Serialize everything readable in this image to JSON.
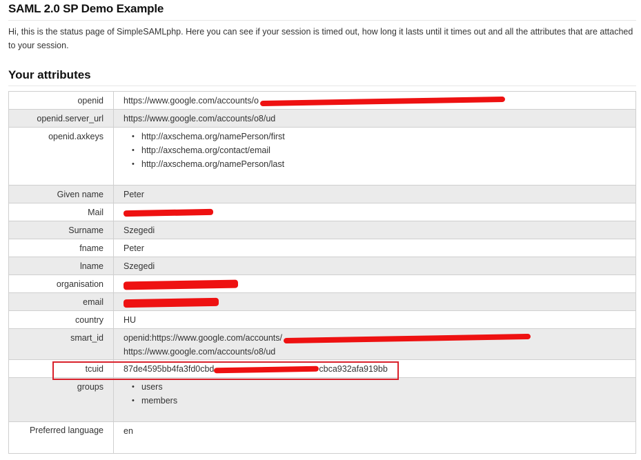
{
  "page": {
    "title": "SAML 2.0 SP Demo Example",
    "intro": "Hi, this is the status page of SimpleSAMLphp. Here you can see if your session is timed out, how long it lasts until it times out and all the attributes that are attached to your session.",
    "section_title": "Your attributes"
  },
  "attributes": [
    {
      "key": "openid",
      "value": "https://www.google.com/accounts/o8/id?id=AItOawkxyzRNjjjg...",
      "redacted": true
    },
    {
      "key": "openid.server_url",
      "value": "https://www.google.com/accounts/o8/ud"
    },
    {
      "key": "openid.axkeys",
      "items": [
        "http://axschema.org/namePerson/first",
        "http://axschema.org/contact/email",
        "http://axschema.org/namePerson/last"
      ]
    },
    {
      "key": "Given name",
      "value": "Peter"
    },
    {
      "key": "Mail",
      "value": "",
      "redacted": true
    },
    {
      "key": "Surname",
      "value": "Szegedi"
    },
    {
      "key": "fname",
      "value": "Peter"
    },
    {
      "key": "lname",
      "value": "Szegedi"
    },
    {
      "key": "organisation",
      "value": "",
      "redacted": true
    },
    {
      "key": "email",
      "value": "",
      "redacted": true
    },
    {
      "key": "country",
      "value": "HU"
    },
    {
      "key": "smart_id",
      "value": "openid:https://www.google.com/accounts/",
      "value2": "https://www.google.com/accounts/o8/ud",
      "redacted": true
    },
    {
      "key": "tcuid",
      "value": "87de4595bb4fa3fd0cbd",
      "value_tail": "cbca932afa919bb",
      "redacted": true
    },
    {
      "key": "groups",
      "items": [
        "users",
        "members"
      ]
    },
    {
      "key": "Preferred language",
      "value": "en"
    }
  ],
  "colors": {
    "redaction": "#e11111",
    "highlight": "#d9202a",
    "row_alt": "#ebebeb"
  }
}
